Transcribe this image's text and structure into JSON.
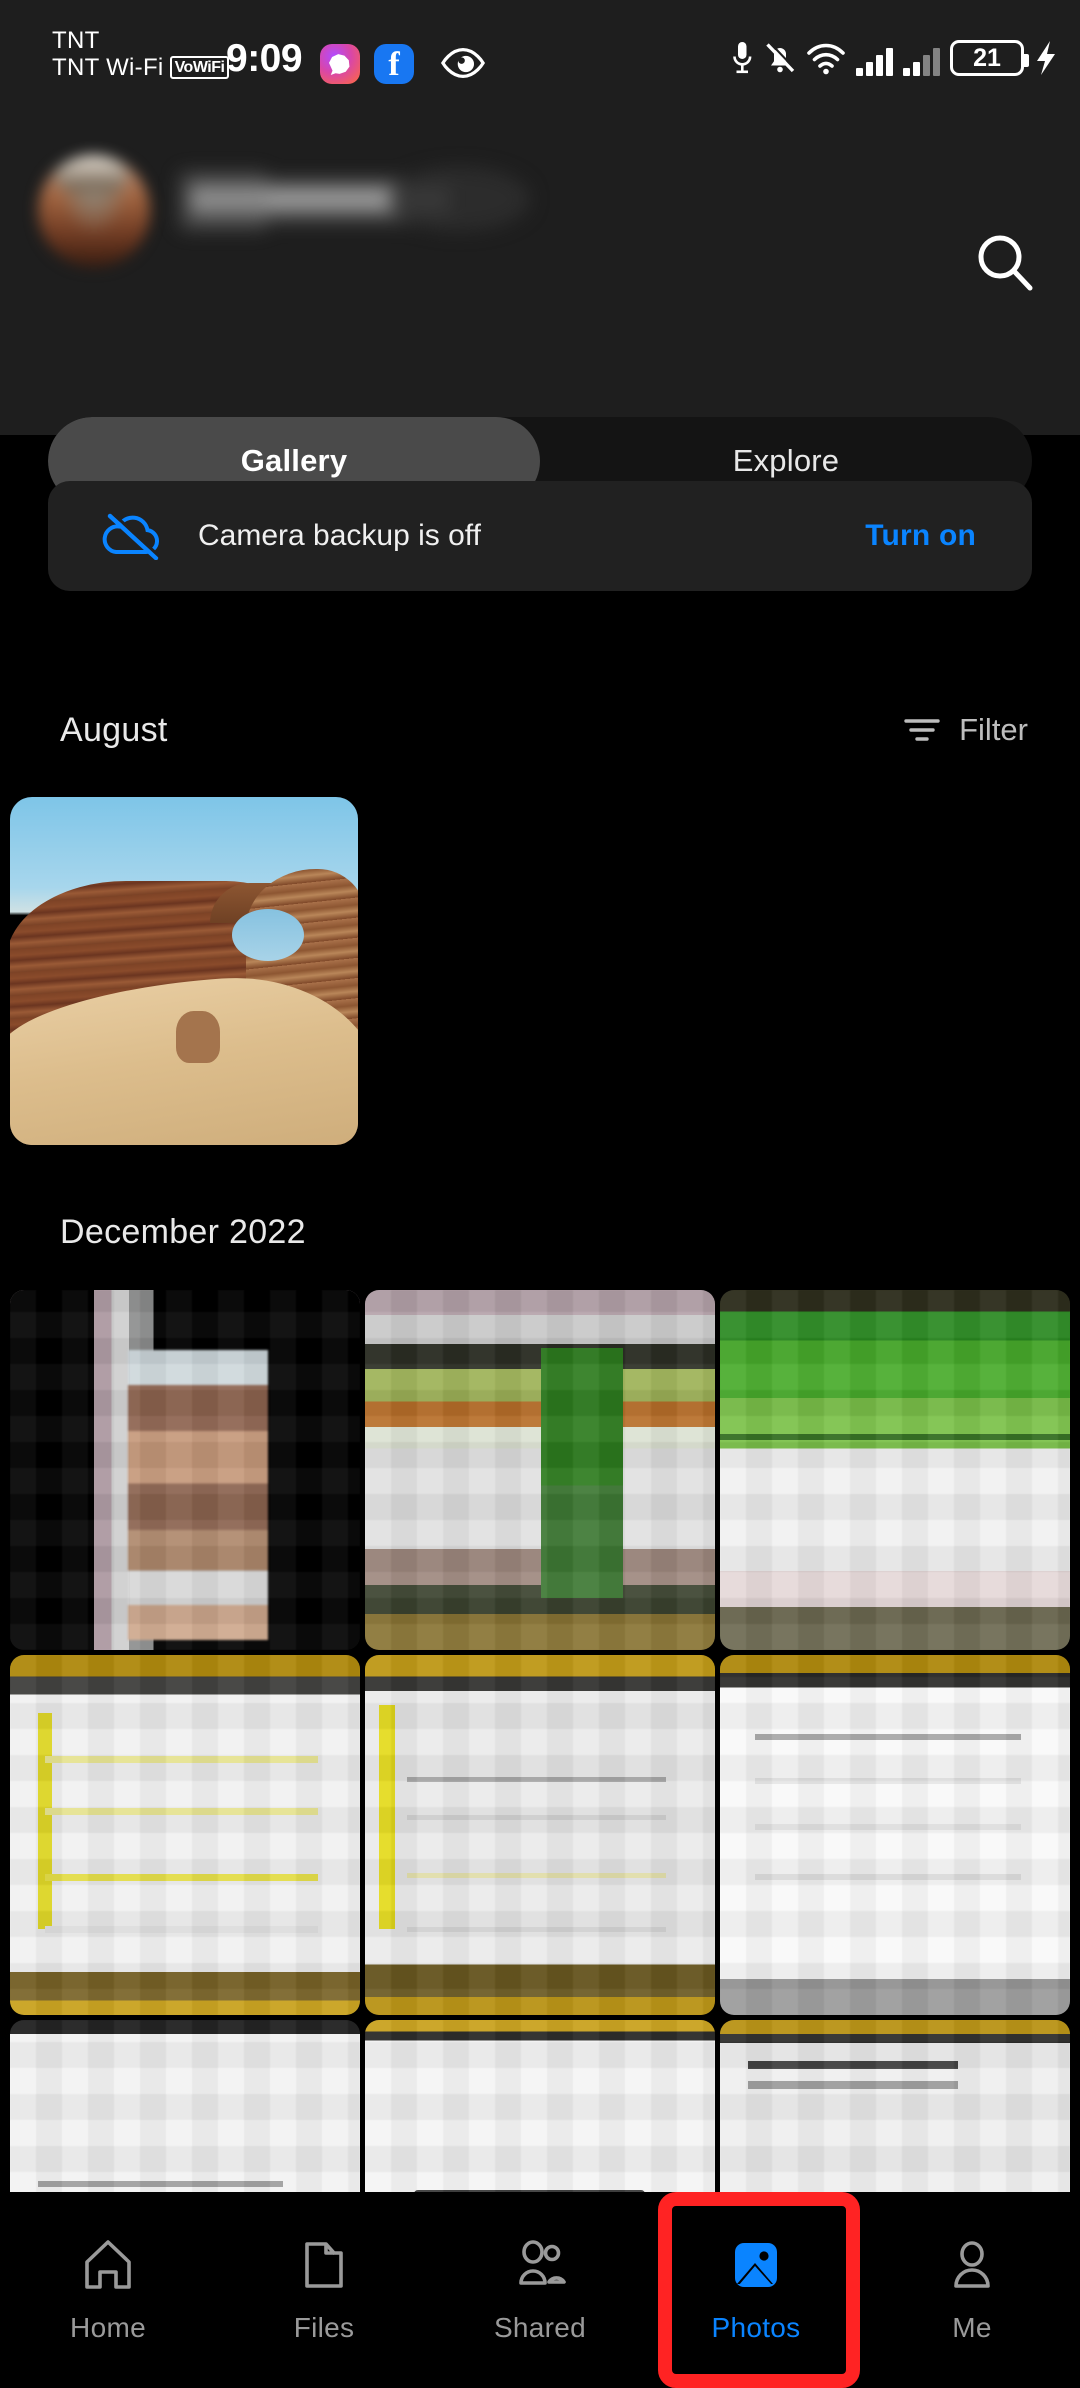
{
  "status_bar": {
    "carrier_line1": "TNT",
    "carrier_line2": "TNT Wi-Fi",
    "vowifi_badge": "VoWiFi",
    "clock": "9:09",
    "battery_percent": "21",
    "icons": [
      "messenger-icon",
      "facebook-icon",
      "eye-icon",
      "microphone-icon",
      "notification-muted-icon",
      "wifi-calling-icon",
      "signal-sim1-icon",
      "signal-sim2-icon",
      "battery-icon",
      "charging-bolt-icon"
    ]
  },
  "header": {
    "account_name_redacted": "",
    "search_icon": "search-icon",
    "tabs": [
      {
        "label": "Gallery",
        "active": true
      },
      {
        "label": "Explore",
        "active": false
      }
    ]
  },
  "banner": {
    "icon": "cloud-off-icon",
    "message": "Camera backup is off",
    "action_label": "Turn on",
    "action_color": "#0a84ff"
  },
  "sections": [
    {
      "title": "August",
      "filter_label": "Filter",
      "filter_icon": "filter-icon",
      "items": [
        {
          "name": "desert-rock-arch-photo"
        }
      ]
    },
    {
      "title": "December 2022",
      "items": [
        {
          "name": "photo-blurred-1"
        },
        {
          "name": "photo-blurred-2"
        },
        {
          "name": "photo-blurred-3"
        },
        {
          "name": "photo-blurred-4"
        },
        {
          "name": "photo-blurred-5"
        },
        {
          "name": "photo-blurred-6"
        },
        {
          "name": "photo-blurred-7"
        },
        {
          "name": "photo-blurred-8"
        },
        {
          "name": "photo-blurred-9"
        }
      ]
    }
  ],
  "bottom_nav": {
    "items": [
      {
        "label": "Home",
        "icon": "home-icon",
        "active": false
      },
      {
        "label": "Files",
        "icon": "folder-icon",
        "active": false
      },
      {
        "label": "Shared",
        "icon": "people-icon",
        "active": false
      },
      {
        "label": "Photos",
        "icon": "photo-icon",
        "active": true
      },
      {
        "label": "Me",
        "icon": "person-icon",
        "active": false
      }
    ],
    "active_color": "#0a84ff",
    "inactive_color": "#9a9a9a",
    "highlight_color": "#ff2323",
    "highlight_target": "Photos"
  }
}
